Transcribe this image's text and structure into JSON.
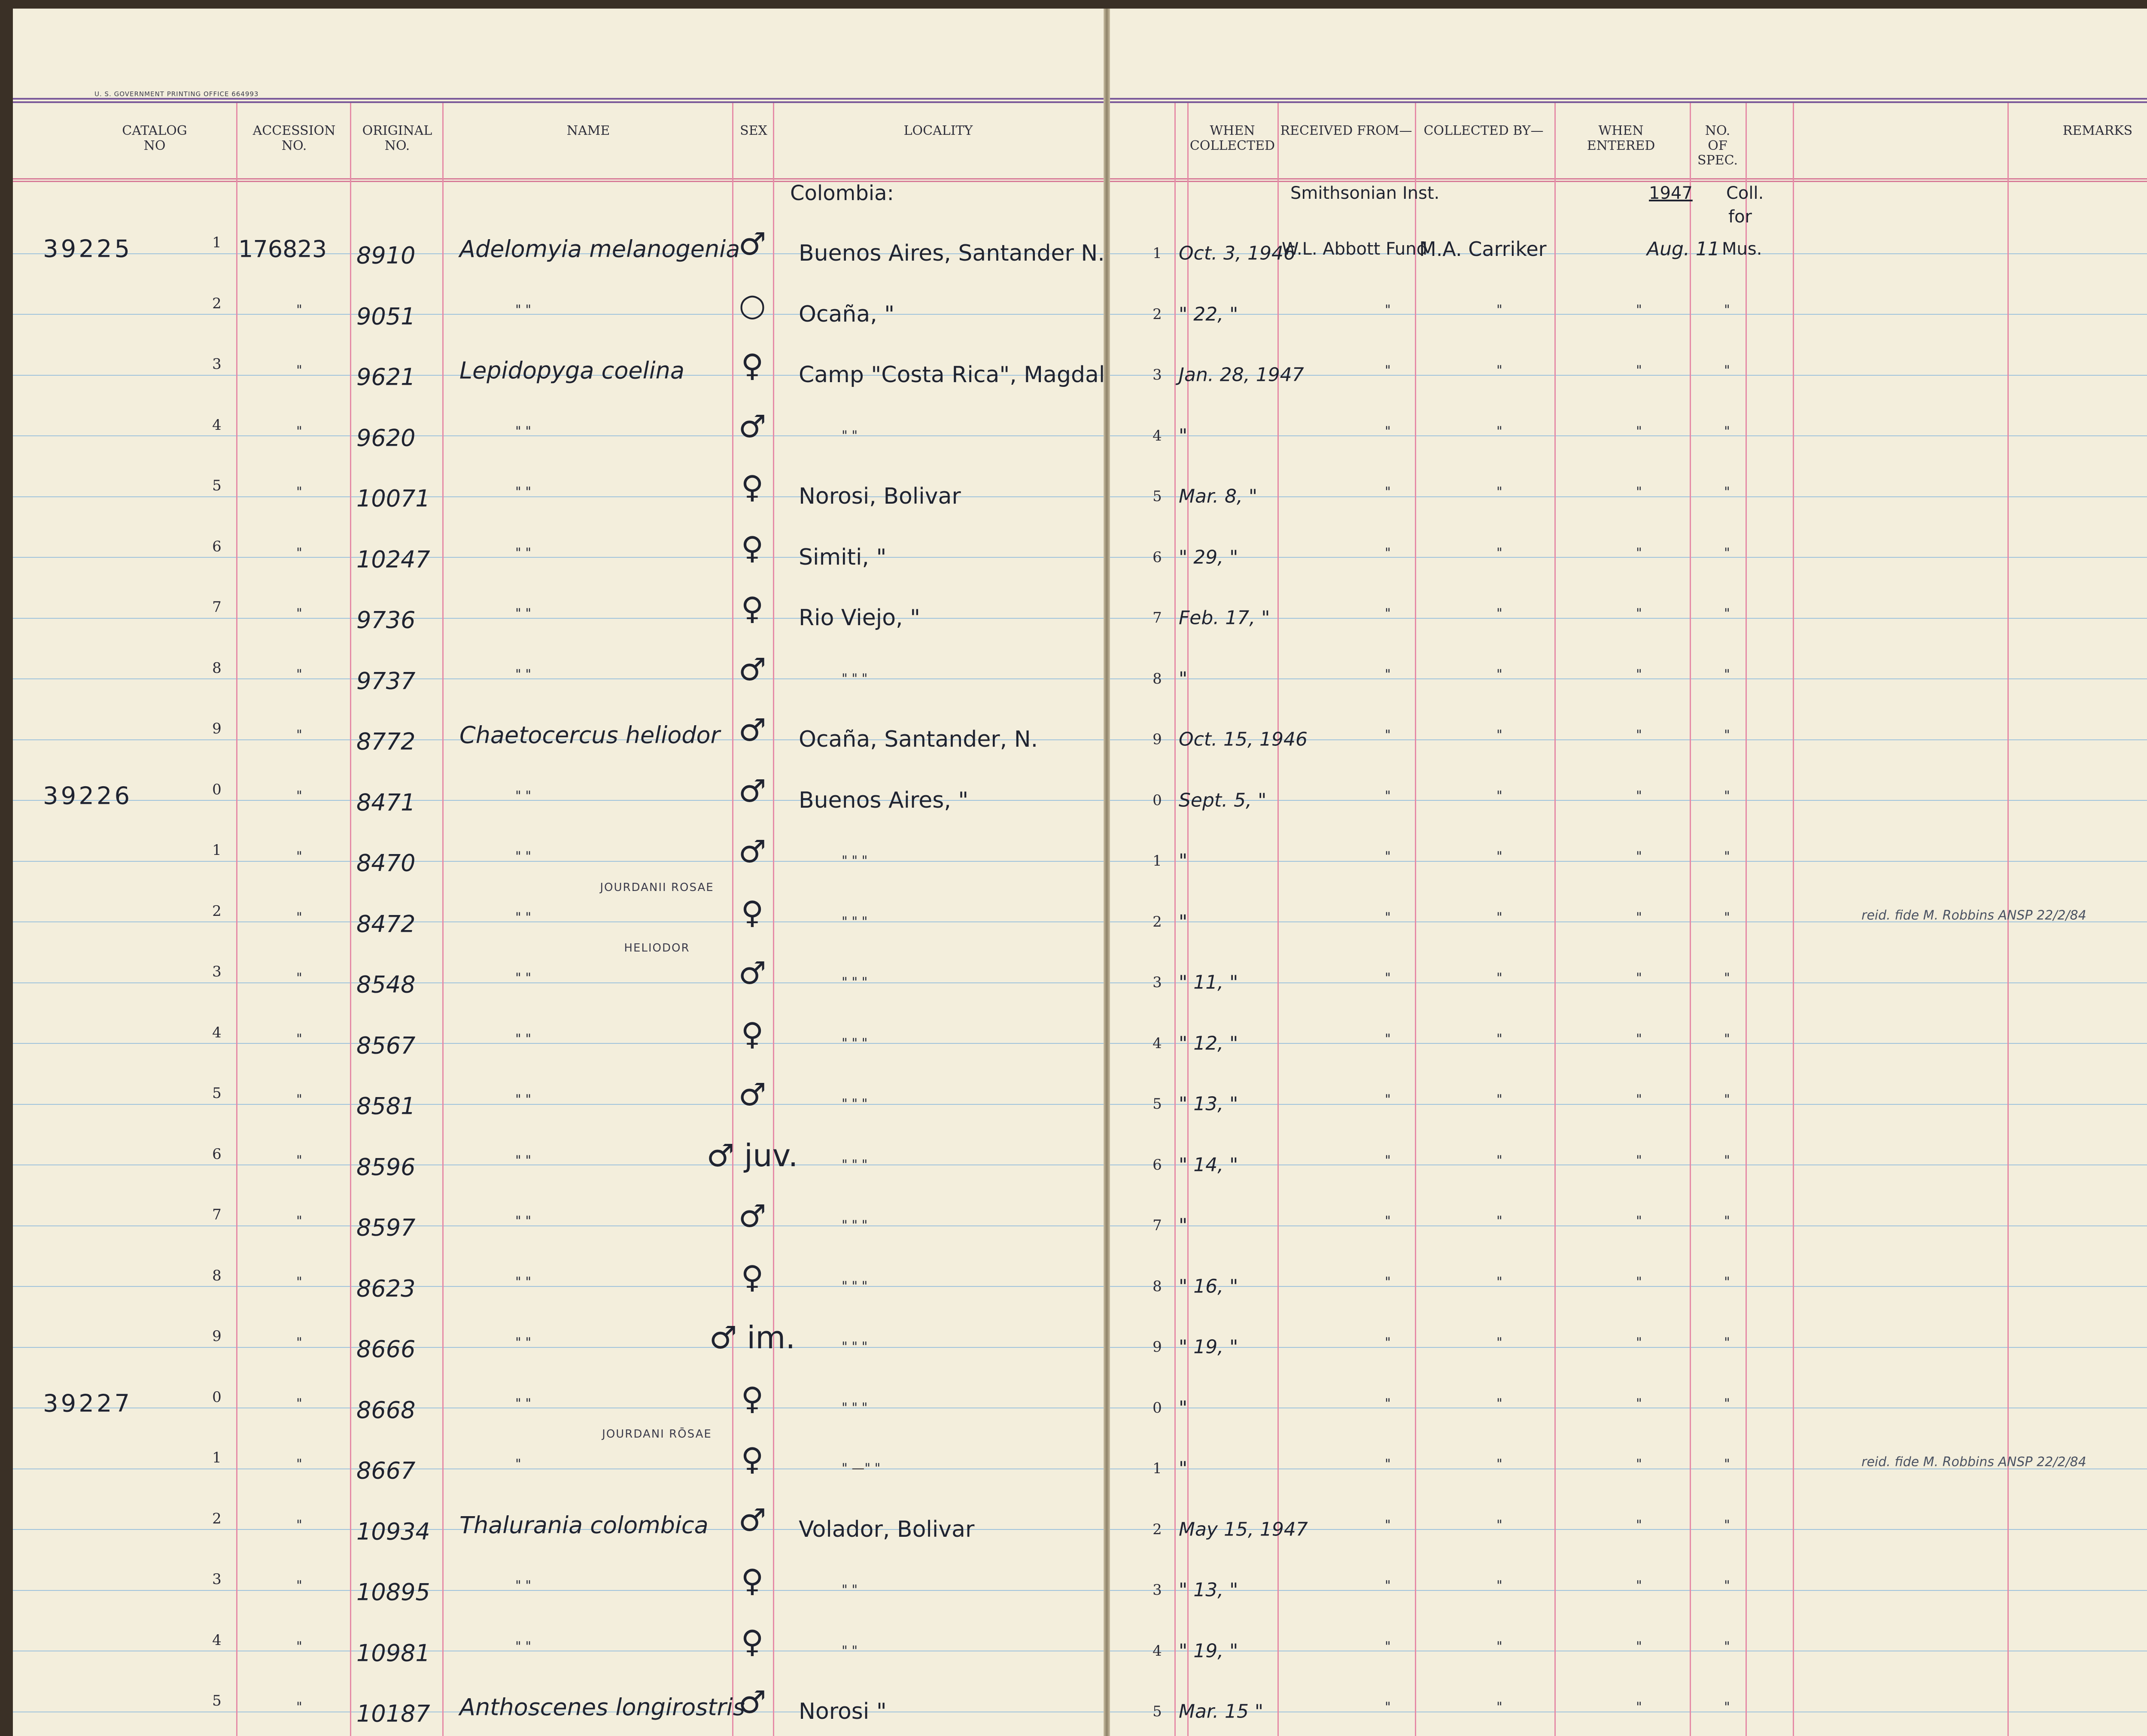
{
  "printer_note": "U. S. GOVERNMENT PRINTING OFFICE    664993",
  "headers": {
    "catalog_no": "CATALOG\nNO",
    "accession_no": "ACCESSION\nNO.",
    "original_no": "ORIGINAL\nNO.",
    "name": "NAME",
    "sex": "SEX",
    "locality": "LOCALITY",
    "when_collected": "WHEN\nCOLLECTED",
    "received_from": "RECEIVED FROM—",
    "collected_by": "COLLECTED BY—",
    "when_entered": "WHEN\nENTERED",
    "no_of_spec": "NO.\nOF\nSPEC.",
    "remarks": "REMARKS"
  },
  "top_notes": {
    "locality": "Colombia:",
    "received_from": "Smithsonian Inst.",
    "when_entered_year": "1947",
    "no_spec_line1": "Coll.",
    "no_spec_line2": "for"
  },
  "rows": [
    {
      "catalog": "39225",
      "num": "1",
      "accession": "176823",
      "original": "8910",
      "name": "Adelomyia melanogenia",
      "sex": "♂",
      "locality": "Buenos Aires, Santander N.",
      "rnum": "1",
      "when": "Oct. 3, 1946",
      "received": "W.L. Abbott Fund",
      "collector": "M.A. Carriker",
      "entered": "Aug. 11",
      "spec": "Mus."
    },
    {
      "catalog": "",
      "num": "2",
      "accession": "\"",
      "original": "9051",
      "name": "\"        \"",
      "sex": "○",
      "locality": "Ocaña,             \"",
      "rnum": "2",
      "when": "\"  22,  \"",
      "received": "\"",
      "collector": "\"",
      "entered": "\"",
      "spec": "\""
    },
    {
      "catalog": "",
      "num": "3",
      "accession": "\"",
      "original": "9621",
      "name": "Lepidopyga coelina",
      "sex": "♀",
      "locality": "Camp \"Costa Rica\", Magdalena",
      "rnum": "3",
      "when": "Jan. 28, 1947",
      "received": "\"",
      "collector": "\"",
      "entered": "\"",
      "spec": "\""
    },
    {
      "catalog": "",
      "num": "4",
      "accession": "\"",
      "original": "9620",
      "name": "\"        \"",
      "sex": "♂",
      "locality": "\"          \"",
      "rnum": "4",
      "when": "\"",
      "received": "\"",
      "collector": "\"",
      "entered": "\"",
      "spec": "\""
    },
    {
      "catalog": "",
      "num": "5",
      "accession": "\"",
      "original": "10071",
      "name": "\"        \"",
      "sex": "♀",
      "locality": "Norosi, Bolivar",
      "rnum": "5",
      "when": "Mar. 8,  \"",
      "received": "\"",
      "collector": "\"",
      "entered": "\"",
      "spec": "\""
    },
    {
      "catalog": "",
      "num": "6",
      "accession": "\"",
      "original": "10247",
      "name": "\"        \"",
      "sex": "♀",
      "locality": "Simiti,      \"",
      "rnum": "6",
      "when": "\"  29,  \"",
      "received": "\"",
      "collector": "\"",
      "entered": "\"",
      "spec": "\""
    },
    {
      "catalog": "",
      "num": "7",
      "accession": "\"",
      "original": "9736",
      "name": "\"        \"",
      "sex": "♀",
      "locality": "Rio Viejo,    \"",
      "rnum": "7",
      "when": "Feb. 17,  \"",
      "received": "\"",
      "collector": "\"",
      "entered": "\"",
      "spec": "\""
    },
    {
      "catalog": "",
      "num": "8",
      "accession": "\"",
      "original": "9737",
      "name": "\"        \"",
      "sex": "♂",
      "locality": "\"    \"      \"",
      "rnum": "8",
      "when": "\"",
      "received": "\"",
      "collector": "\"",
      "entered": "\"",
      "spec": "\""
    },
    {
      "catalog": "",
      "num": "9",
      "accession": "\"",
      "original": "8772",
      "name": "Chaetocercus heliodor",
      "sex": "♂",
      "locality": "Ocaña, Santander, N.",
      "rnum": "9",
      "when": "Oct. 15, 1946",
      "received": "\"",
      "collector": "\"",
      "entered": "\"",
      "spec": "\""
    },
    {
      "catalog": "39226",
      "num": "0",
      "accession": "\"",
      "original": "8471",
      "name": "\"        \"",
      "sex": "♂",
      "locality": "Buenos Aires,   \"",
      "rnum": "0",
      "when": "Sept. 5,  \"",
      "received": "\"",
      "collector": "\"",
      "entered": "\"",
      "spec": "\""
    },
    {
      "catalog": "",
      "num": "1",
      "accession": "\"",
      "original": "8470",
      "name": "\"        \"",
      "sex": "♂",
      "locality": "\"      \"      \"",
      "rnum": "1",
      "when": "\"",
      "received": "\"",
      "collector": "\"",
      "entered": "\"",
      "spec": "\""
    },
    {
      "catalog": "",
      "num": "2",
      "accession": "\"",
      "original": "8472",
      "name": "\"        \"",
      "sex": "♀",
      "locality": "\"      \"      \"",
      "rnum": "2",
      "when": "\"",
      "received": "\"",
      "collector": "\"",
      "entered": "\"",
      "spec": "\""
    },
    {
      "catalog": "",
      "num": "3",
      "accession": "\"",
      "original": "8548",
      "name": "\"        \"",
      "sex": "♂",
      "locality": "\"      \"      \"",
      "rnum": "3",
      "when": "\"  11,  \"",
      "received": "\"",
      "collector": "\"",
      "entered": "\"",
      "spec": "\""
    },
    {
      "catalog": "",
      "num": "4",
      "accession": "\"",
      "original": "8567",
      "name": "\"        \"",
      "sex": "♀",
      "locality": "\"      \"      \"",
      "rnum": "4",
      "when": "\"  12,  \"",
      "received": "\"",
      "collector": "\"",
      "entered": "\"",
      "spec": "\""
    },
    {
      "catalog": "",
      "num": "5",
      "accession": "\"",
      "original": "8581",
      "name": "\"        \"",
      "sex": "♂",
      "locality": "\"      \"      \"",
      "rnum": "5",
      "when": "\"  13,  \"",
      "received": "\"",
      "collector": "\"",
      "entered": "\"",
      "spec": "\""
    },
    {
      "catalog": "",
      "num": "6",
      "accession": "\"",
      "original": "8596",
      "name": "\"        \"",
      "sex": "♂ juv.",
      "locality": "\"      \"      \"",
      "rnum": "6",
      "when": "\"  14,  \"",
      "received": "\"",
      "collector": "\"",
      "entered": "\"",
      "spec": "\""
    },
    {
      "catalog": "",
      "num": "7",
      "accession": "\"",
      "original": "8597",
      "name": "\"        \"",
      "sex": "♂",
      "locality": "\"      \"      \"",
      "rnum": "7",
      "when": "\"",
      "received": "\"",
      "collector": "\"",
      "entered": "\"",
      "spec": "\""
    },
    {
      "catalog": "",
      "num": "8",
      "accession": "\"",
      "original": "8623",
      "name": "\"        \"",
      "sex": "♀",
      "locality": "\"      \"      \"",
      "rnum": "8",
      "when": "\"  16,  \"",
      "received": "\"",
      "collector": "\"",
      "entered": "\"",
      "spec": "\""
    },
    {
      "catalog": "",
      "num": "9",
      "accession": "\"",
      "original": "8666",
      "name": "\"        \"",
      "sex": "♂ im.",
      "locality": "\"      \"      \"",
      "rnum": "9",
      "when": "\"  19,  \"",
      "received": "\"",
      "collector": "\"",
      "entered": "\"",
      "spec": "\""
    },
    {
      "catalog": "39227",
      "num": "0",
      "accession": "\"",
      "original": "8668",
      "name": "\"        \"",
      "sex": "♀",
      "locality": "\"      \"      \"",
      "rnum": "0",
      "when": "\"",
      "received": "\"",
      "collector": "\"",
      "entered": "\"",
      "spec": "\""
    },
    {
      "catalog": "",
      "num": "1",
      "accession": "\"",
      "original": "8667",
      "name": "\"",
      "sex": "♀",
      "locality": "\"    —\"      \"",
      "rnum": "1",
      "when": "\"",
      "received": "\"",
      "collector": "\"",
      "entered": "\"",
      "spec": "\""
    },
    {
      "catalog": "",
      "num": "2",
      "accession": "\"",
      "original": "10934",
      "name": "Thalurania colombica",
      "sex": "♂",
      "locality": "Volador, Bolivar",
      "rnum": "2",
      "when": "May 15, 1947",
      "received": "\"",
      "collector": "\"",
      "entered": "\"",
      "spec": "\""
    },
    {
      "catalog": "",
      "num": "3",
      "accession": "\"",
      "original": "10895",
      "name": "\"        \"",
      "sex": "♀",
      "locality": "\"        \"",
      "rnum": "3",
      "when": "\"  13,  \"",
      "received": "\"",
      "collector": "\"",
      "entered": "\"",
      "spec": "\""
    },
    {
      "catalog": "",
      "num": "4",
      "accession": "\"",
      "original": "10981",
      "name": "\"        \"",
      "sex": "♀",
      "locality": "\"        \"",
      "rnum": "4",
      "when": "\"  19,  \"",
      "received": "\"",
      "collector": "\"",
      "entered": "\"",
      "spec": "\""
    },
    {
      "catalog": "",
      "num": "5",
      "accession": "\"",
      "original": "10187",
      "name": "Anthoscenes longirostris",
      "sex": "♂",
      "locality": "Norosi          \"",
      "rnum": "5",
      "when": "Mar. 15  \"",
      "received": "\"",
      "collector": "\"",
      "entered": "\"",
      "spec": "\""
    }
  ],
  "stamps": [
    {
      "row": 11,
      "text": "JOURDANII ROSAE"
    },
    {
      "row": 12,
      "text": "HELIODOR"
    },
    {
      "row": 20,
      "text": "JOURDANI RŌSAE"
    }
  ],
  "remarks": [
    {
      "row": 11,
      "text": "reid. fide M. Robbins ANSP 22/2/84"
    },
    {
      "row": 20,
      "text": "reid. fide M. Robbins ANSP 22/2/84"
    }
  ]
}
